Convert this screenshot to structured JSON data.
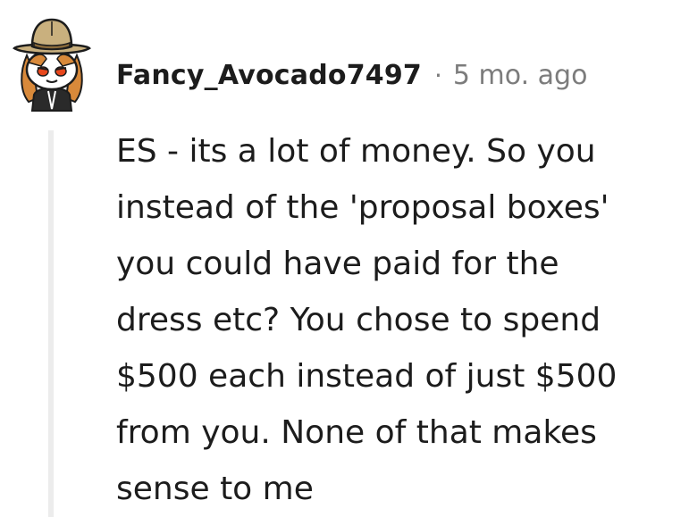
{
  "comment": {
    "author": "Fancy_Avocado7497",
    "separator": "·",
    "timestamp": "5 mo. ago",
    "body_lines": [
      "ES - its a lot of money. So you",
      "instead of the 'proposal boxes'",
      "you could have paid for the",
      "dress etc? You chose to spend",
      "$500 each instead of just $500",
      "from you. None of that makes",
      "sense to me"
    ],
    "avatar_icon": "snoo-cowboy-hat-avatar-icon"
  },
  "colors": {
    "text": "#1c1c1c",
    "meta": "#7c7c7c",
    "thread_line": "#ececec"
  }
}
